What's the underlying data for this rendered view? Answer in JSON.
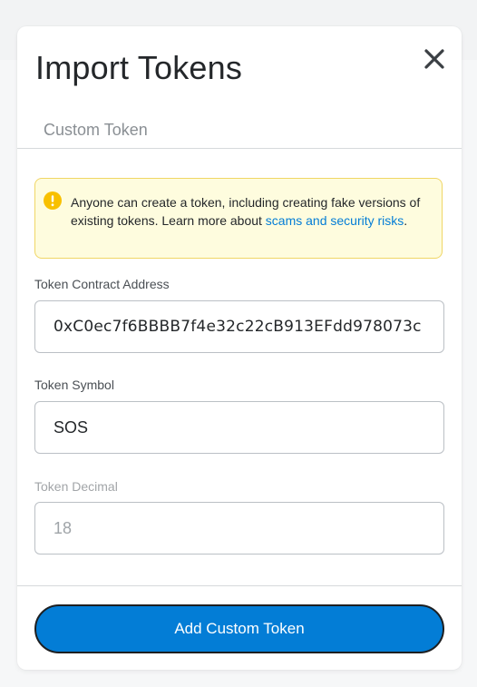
{
  "modal": {
    "title": "Import Tokens",
    "tab_label": "Custom Token"
  },
  "warning": {
    "text": "Anyone can create a token, including creating fake versions of existing tokens. Learn more about ",
    "link_text": "scams and security risks",
    "trailing": "."
  },
  "fields": {
    "contract_address": {
      "label": "Token Contract Address",
      "value": "0xC0ec7f6BBBB7f4e32c22cB913EFdd978073c"
    },
    "symbol": {
      "label": "Token Symbol",
      "value": "SOS"
    },
    "decimal": {
      "label": "Token Decimal",
      "value": "18"
    }
  },
  "actions": {
    "add_label": "Add Custom Token"
  },
  "icons": {
    "close": "close-icon",
    "warning": "info-icon"
  },
  "colors": {
    "accent": "#037dd6",
    "warning_bg": "#fefcde",
    "warning_border": "#f0d665",
    "warning_icon": "#f8c000",
    "text_primary": "#24272a"
  }
}
